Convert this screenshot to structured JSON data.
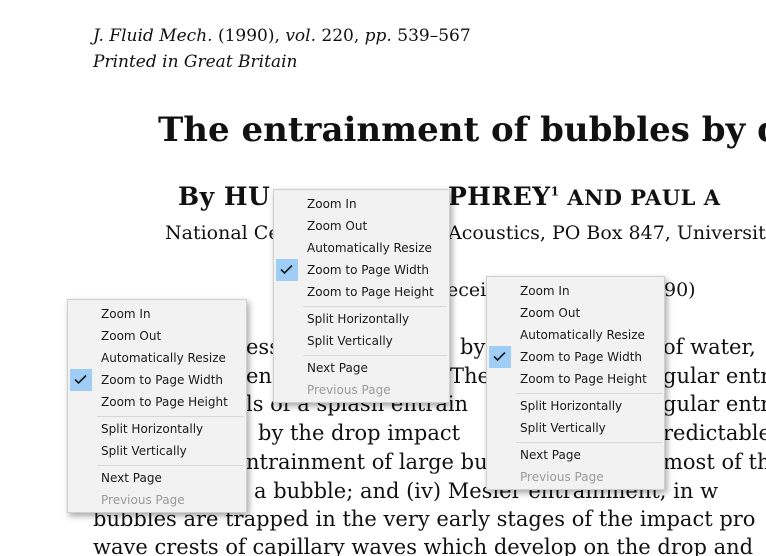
{
  "document": {
    "journal_line": {
      "journal": "J. Fluid Mech.",
      "year": "(1990),",
      "vol_label": "vol.",
      "vol": "220,",
      "pp_label": "pp.",
      "pages": "539–567"
    },
    "printed": "Printed in Great Britain",
    "title": "The entrainment of bubbles by dro",
    "authors": "By HU",
    "authors_mid": "PHREY",
    "authors_sup": "1",
    "authors_and": " AND PAUL A",
    "affiliation_left": "National Ce",
    "affiliation_right": "Acoustics, PO Box 847, Universit",
    "received_left": "ecei",
    "received_right": "90)",
    "body_lines": [
      {
        "left": "esse",
        "right": "by",
        "far": "of water,"
      },
      {
        "left": "en",
        "right": "The",
        "far": "gular entr"
      },
      {
        "left": "ls of a splash entrain",
        "right": "",
        "far": "gular entr"
      },
      {
        "left": "by the drop impact",
        "right": "",
        "far": "redictable"
      },
      {
        "left": "ntrainment of large bu",
        "right": "",
        "far": "most of th"
      },
      {
        "left": "a bubble; and (iv) Mesler entrainment, in w",
        "right": "",
        "far": ""
      },
      {
        "left": "bubbles are trapped in the very early stages of the impact pro",
        "right": "",
        "far": ""
      },
      {
        "left": "wave crests of capillary waves which develop on the drop and",
        "right": "",
        "far": ""
      }
    ]
  },
  "menus": [
    {
      "id": "left",
      "items": [
        {
          "label": "Zoom In",
          "enabled": true,
          "checked": false
        },
        {
          "label": "Zoom Out",
          "enabled": true,
          "checked": false
        },
        {
          "label": "Automatically Resize",
          "enabled": true,
          "checked": false
        },
        {
          "label": "Zoom to Page Width",
          "enabled": true,
          "checked": true
        },
        {
          "label": "Zoom to Page Height",
          "enabled": true,
          "checked": false
        },
        {
          "label": "Split Horizontally",
          "enabled": true,
          "checked": false
        },
        {
          "label": "Split Vertically",
          "enabled": true,
          "checked": false
        },
        {
          "label": "Next Page",
          "enabled": true,
          "checked": false
        },
        {
          "label": "Previous Page",
          "enabled": false,
          "checked": false
        }
      ]
    },
    {
      "id": "middle",
      "items": [
        {
          "label": "Zoom In",
          "enabled": true,
          "checked": false
        },
        {
          "label": "Zoom Out",
          "enabled": true,
          "checked": false
        },
        {
          "label": "Automatically Resize",
          "enabled": true,
          "checked": false
        },
        {
          "label": "Zoom to Page Width",
          "enabled": true,
          "checked": true
        },
        {
          "label": "Zoom to Page Height",
          "enabled": true,
          "checked": false
        },
        {
          "label": "Split Horizontally",
          "enabled": true,
          "checked": false
        },
        {
          "label": "Split Vertically",
          "enabled": true,
          "checked": false
        },
        {
          "label": "Next Page",
          "enabled": true,
          "checked": false
        },
        {
          "label": "Previous Page",
          "enabled": false,
          "checked": false
        }
      ]
    },
    {
      "id": "right",
      "items": [
        {
          "label": "Zoom In",
          "enabled": true,
          "checked": false
        },
        {
          "label": "Zoom Out",
          "enabled": true,
          "checked": false
        },
        {
          "label": "Automatically Resize",
          "enabled": true,
          "checked": false
        },
        {
          "label": "Zoom to Page Width",
          "enabled": true,
          "checked": true
        },
        {
          "label": "Zoom to Page Height",
          "enabled": true,
          "checked": false
        },
        {
          "label": "Split Horizontally",
          "enabled": true,
          "checked": false
        },
        {
          "label": "Split Vertically",
          "enabled": true,
          "checked": false
        },
        {
          "label": "Next Page",
          "enabled": true,
          "checked": false
        },
        {
          "label": "Previous Page",
          "enabled": false,
          "checked": false
        }
      ]
    }
  ],
  "colors": {
    "check_highlight": "#9fcdf5",
    "disabled_text": "#9a9a9a",
    "menu_bg": "#f2f2f2"
  }
}
